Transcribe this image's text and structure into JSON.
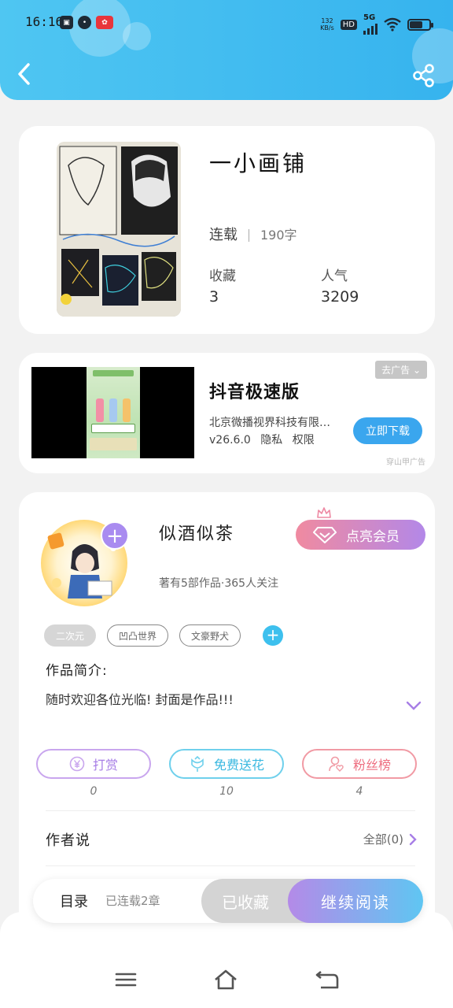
{
  "status_bar": {
    "time": "16:16",
    "speed_value": "132",
    "speed_unit": "KB/s",
    "hd": "HD",
    "network": "5G"
  },
  "book": {
    "title": "一小画铺",
    "status": "连载",
    "words": "190字",
    "collect_label": "收藏",
    "collect_value": "3",
    "popularity_label": "人气",
    "popularity_value": "3209"
  },
  "ad": {
    "title": "抖音极速版",
    "company": "北京微播视界科技有限…",
    "version": "v26.6.0",
    "privacy": "隐私",
    "permission": "权限",
    "tag": "去广告",
    "download_label": "立即下载",
    "source": "穿山甲广告"
  },
  "author": {
    "name": "似酒似茶",
    "stats": "著有5部作品·365人关注",
    "vip_label": "点亮会员",
    "tags": [
      "二次元",
      "凹凸世界",
      "文豪野犬"
    ],
    "intro_label": "作品简介:",
    "intro_text": "随时欢迎各位光临! 封面是作品!!!"
  },
  "actions": {
    "reward_label": "打赏",
    "reward_count": "0",
    "flower_label": "免费送花",
    "flower_count": "10",
    "fans_label": "粉丝榜",
    "fans_count": "4"
  },
  "author_says": {
    "label": "作者说",
    "all_label": "全部(0)"
  },
  "read_bar": {
    "toc_label": "目录",
    "toc_status": "已连载2章",
    "collected_label": "已收藏",
    "continue_label": "继续阅读"
  },
  "colors": {
    "header": "#3bb7ef",
    "vip_start": "#f08aa0",
    "vip_end": "#b388e8",
    "download": "#3aa6ee"
  }
}
